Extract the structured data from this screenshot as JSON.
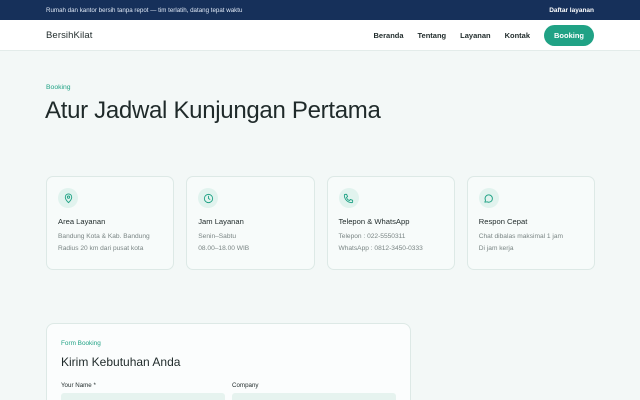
{
  "topbar": {
    "tagline": "Rumah dan kantor bersih tanpa repot — tim terlatih, datang tepat waktu",
    "link": "Daftar layanan"
  },
  "header": {
    "brand": "BersihKilat",
    "nav": [
      "Beranda",
      "Tentang",
      "Layanan",
      "Kontak"
    ],
    "cta": "Booking"
  },
  "hero": {
    "eyebrow": "Booking",
    "title": "Atur Jadwal Kunjungan Pertama"
  },
  "cards": [
    {
      "icon": "map-pin-icon",
      "title": "Area Layanan",
      "lines": [
        "Bandung Kota & Kab. Bandung",
        "Radius 20 km dari pusat kota"
      ]
    },
    {
      "icon": "clock-icon",
      "title": "Jam Layanan",
      "lines": [
        "Senin–Sabtu",
        "08.00–18.00 WIB"
      ]
    },
    {
      "icon": "phone-icon",
      "title": "Telepon & WhatsApp",
      "lines": [
        "Telepon : 022-5550311",
        "WhatsApp : 0812-3450-0333"
      ]
    },
    {
      "icon": "chat-icon",
      "title": "Respon Cepat",
      "lines": [
        "Chat dibalas maksimal 1 jam",
        "Di jam kerja"
      ]
    }
  ],
  "form": {
    "eyebrow": "Form Booking",
    "title": "Kirim Kebutuhan Anda",
    "fields": [
      {
        "label": "Your Name *",
        "value": ""
      },
      {
        "label": "Company",
        "value": ""
      }
    ]
  },
  "colors": {
    "accent": "#20a285",
    "topbar": "#16305a",
    "background": "#f3f8f7"
  }
}
